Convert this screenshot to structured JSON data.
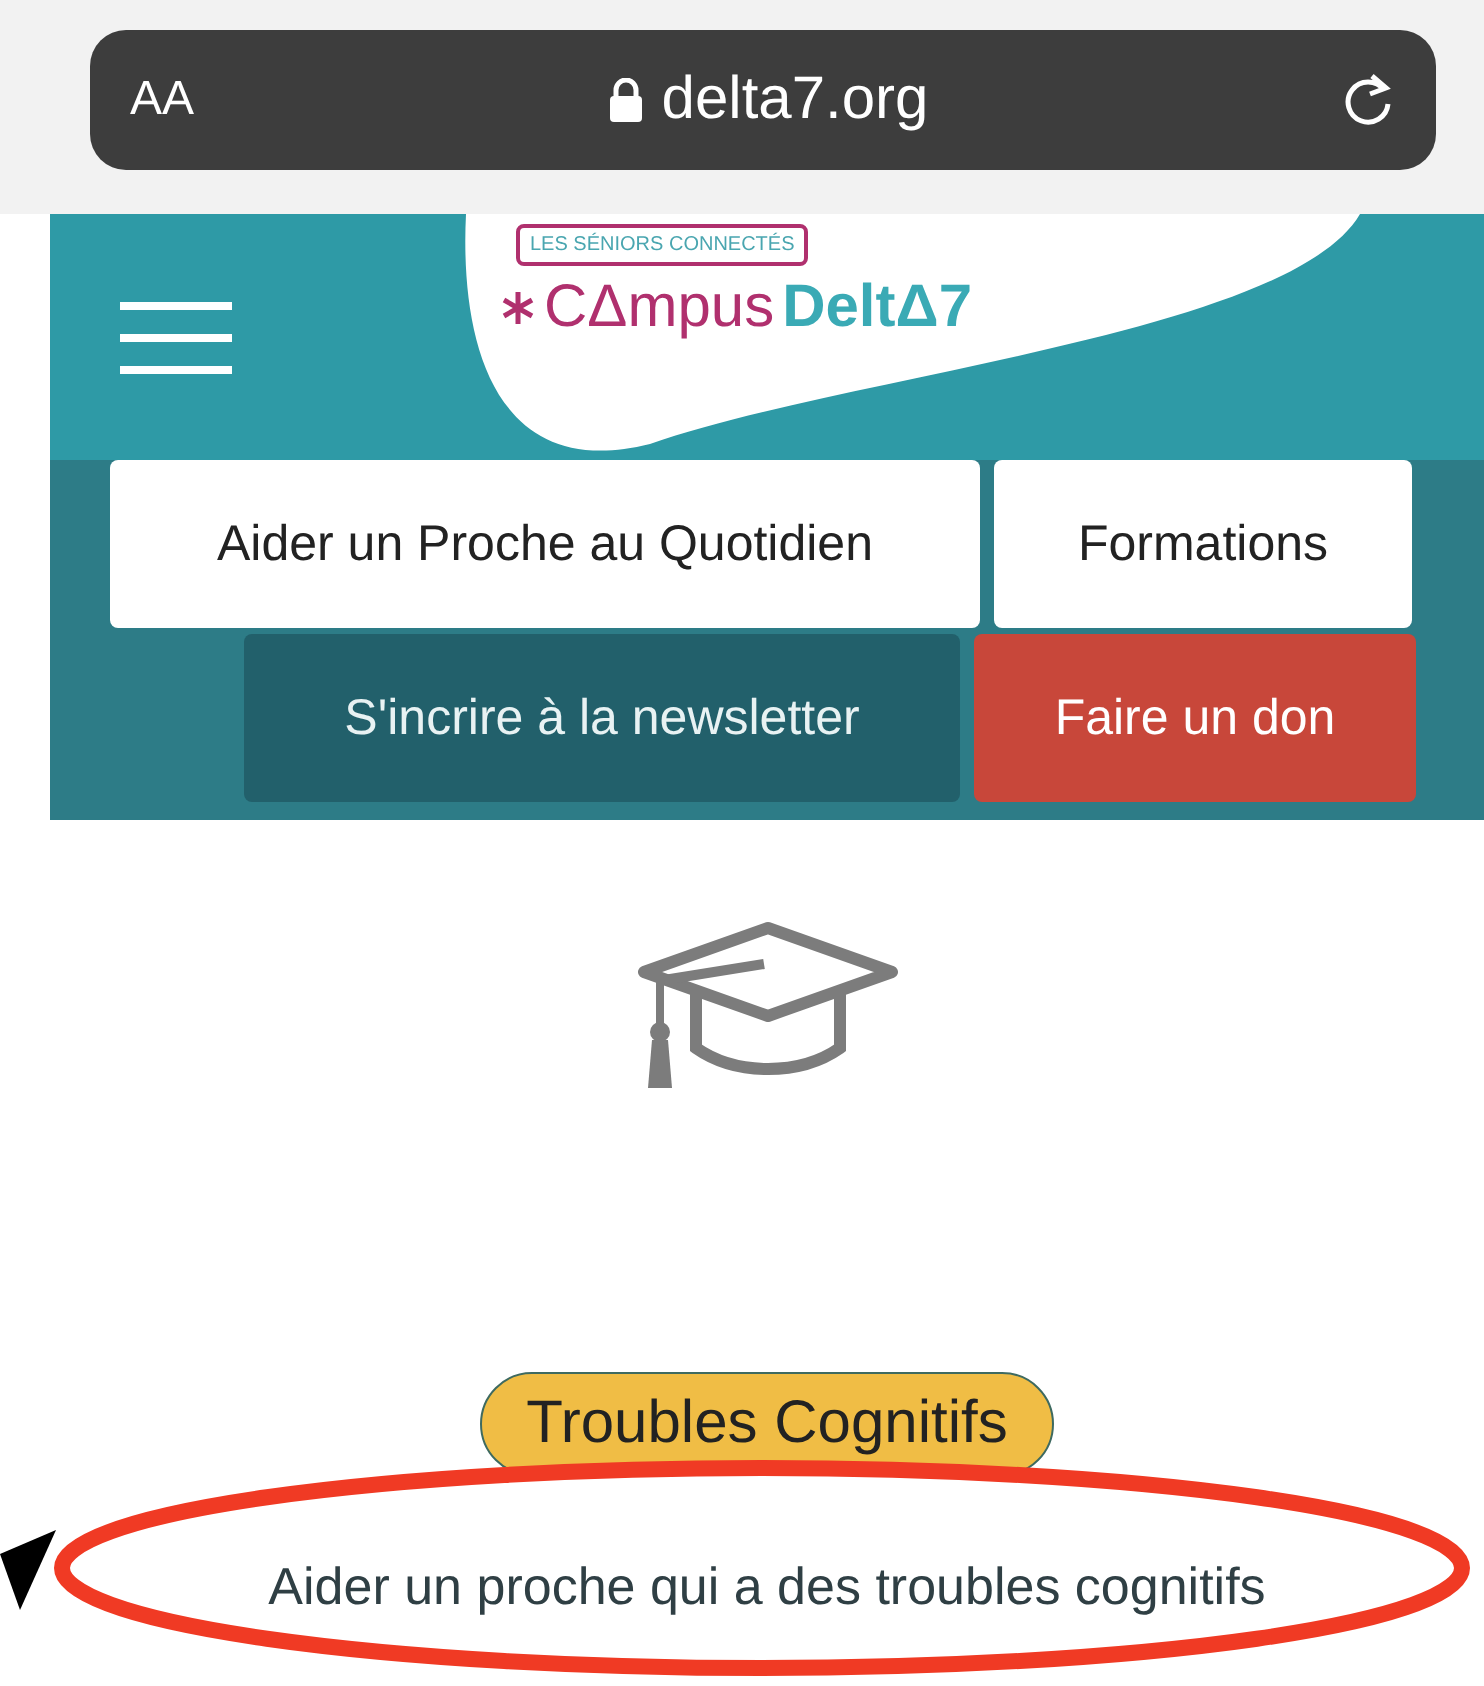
{
  "browser": {
    "text_size_button": "AA",
    "url": "delta7.org"
  },
  "header": {
    "logo": {
      "tagline": "LES SÉNIORS CONNECTÉS",
      "word_1": "CΔmpus",
      "word_2": "DeltΔ7"
    }
  },
  "nav": {
    "rows": [
      [
        {
          "label": "Aider un Proche au Quotidien",
          "kind": "light"
        },
        {
          "label": "Formations",
          "kind": "light"
        }
      ],
      [
        {
          "label": "S'incrire à la newsletter",
          "kind": "dark"
        },
        {
          "label": "Faire un don",
          "kind": "accent"
        }
      ]
    ]
  },
  "content": {
    "badge": "Troubles Cognitifs",
    "title": "Aider un proche qui a des troubles cognitifs"
  }
}
